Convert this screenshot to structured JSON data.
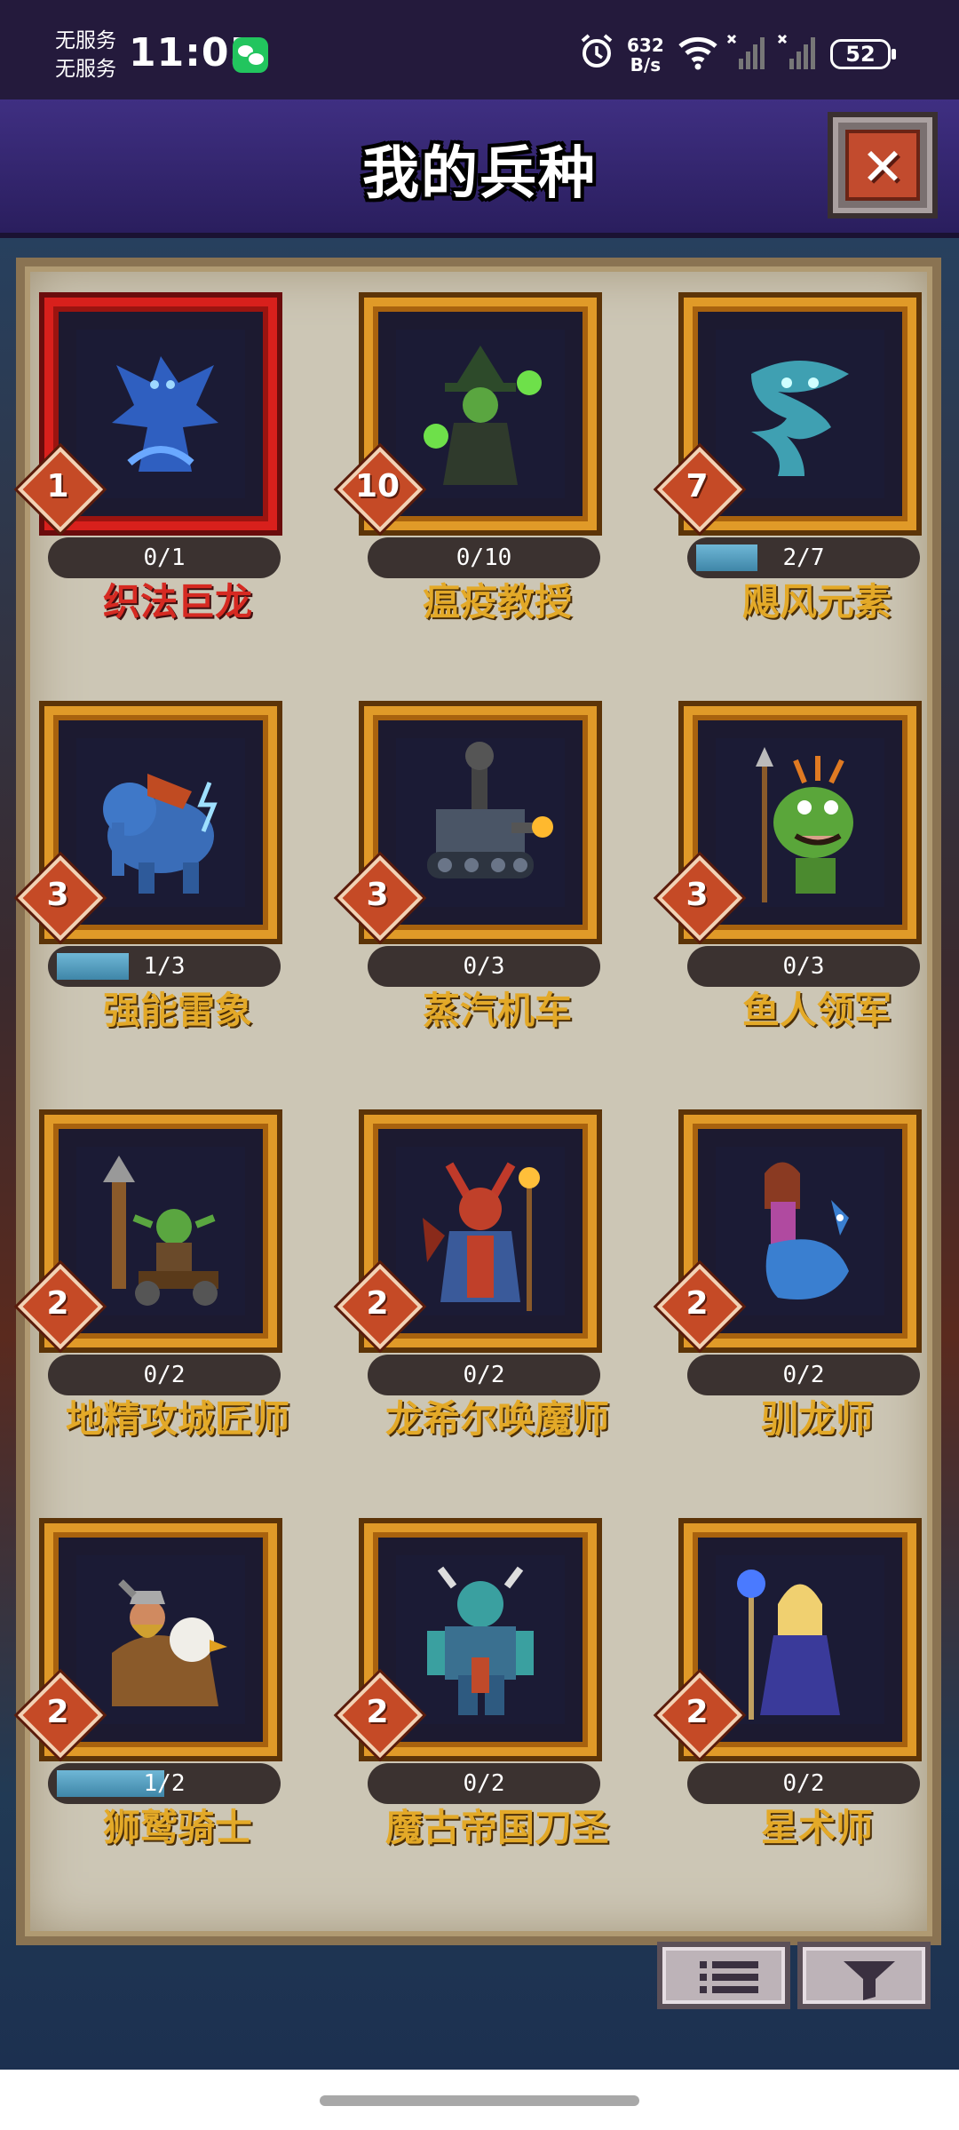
{
  "status_bar": {
    "carrier_line1": "无服务",
    "carrier_line2": "无服务",
    "time": "11:05",
    "net_speed_value": "632",
    "net_speed_unit": "B/s",
    "battery": "52"
  },
  "header": {
    "title": "我的兵种"
  },
  "units": [
    {
      "level": "1",
      "progress": "0/1",
      "fraction": 0.0,
      "name": "织法巨龙",
      "selected": true,
      "icon": "blue-dragon"
    },
    {
      "level": "10",
      "progress": "0/10",
      "fraction": 0.0,
      "name": "瘟疫教授",
      "selected": false,
      "icon": "plague-professor"
    },
    {
      "level": "7",
      "progress": "2/7",
      "fraction": 0.2857,
      "name": "飓风元素",
      "selected": false,
      "icon": "cyclone-elemental"
    },
    {
      "level": "3",
      "progress": "1/3",
      "fraction": 0.3333,
      "name": "强能雷象",
      "selected": false,
      "icon": "thunder-elephant"
    },
    {
      "level": "3",
      "progress": "0/3",
      "fraction": 0.0,
      "name": "蒸汽机车",
      "selected": false,
      "icon": "steam-tank"
    },
    {
      "level": "3",
      "progress": "0/3",
      "fraction": 0.0,
      "name": "鱼人领军",
      "selected": false,
      "icon": "murloc-leader"
    },
    {
      "level": "2",
      "progress": "0/2",
      "fraction": 0.0,
      "name": "地精攻城匠师",
      "selected": false,
      "icon": "goblin-siege"
    },
    {
      "level": "2",
      "progress": "0/2",
      "fraction": 0.0,
      "name": "龙希尔唤魔师",
      "selected": false,
      "icon": "demon-caller"
    },
    {
      "level": "2",
      "progress": "0/2",
      "fraction": 0.0,
      "name": "驯龙师",
      "selected": false,
      "icon": "dragon-tamer"
    },
    {
      "level": "2",
      "progress": "1/2",
      "fraction": 0.5,
      "name": "狮鹫骑士",
      "selected": false,
      "icon": "gryphon-rider"
    },
    {
      "level": "2",
      "progress": "0/2",
      "fraction": 0.0,
      "name": "魔古帝国刀圣",
      "selected": false,
      "icon": "mogu-blademaster"
    },
    {
      "level": "2",
      "progress": "0/2",
      "fraction": 0.0,
      "name": "星术师",
      "selected": false,
      "icon": "astromancer"
    }
  ],
  "bottom_buttons": [
    {
      "icon": "list-icon"
    },
    {
      "icon": "filter-icon"
    }
  ]
}
